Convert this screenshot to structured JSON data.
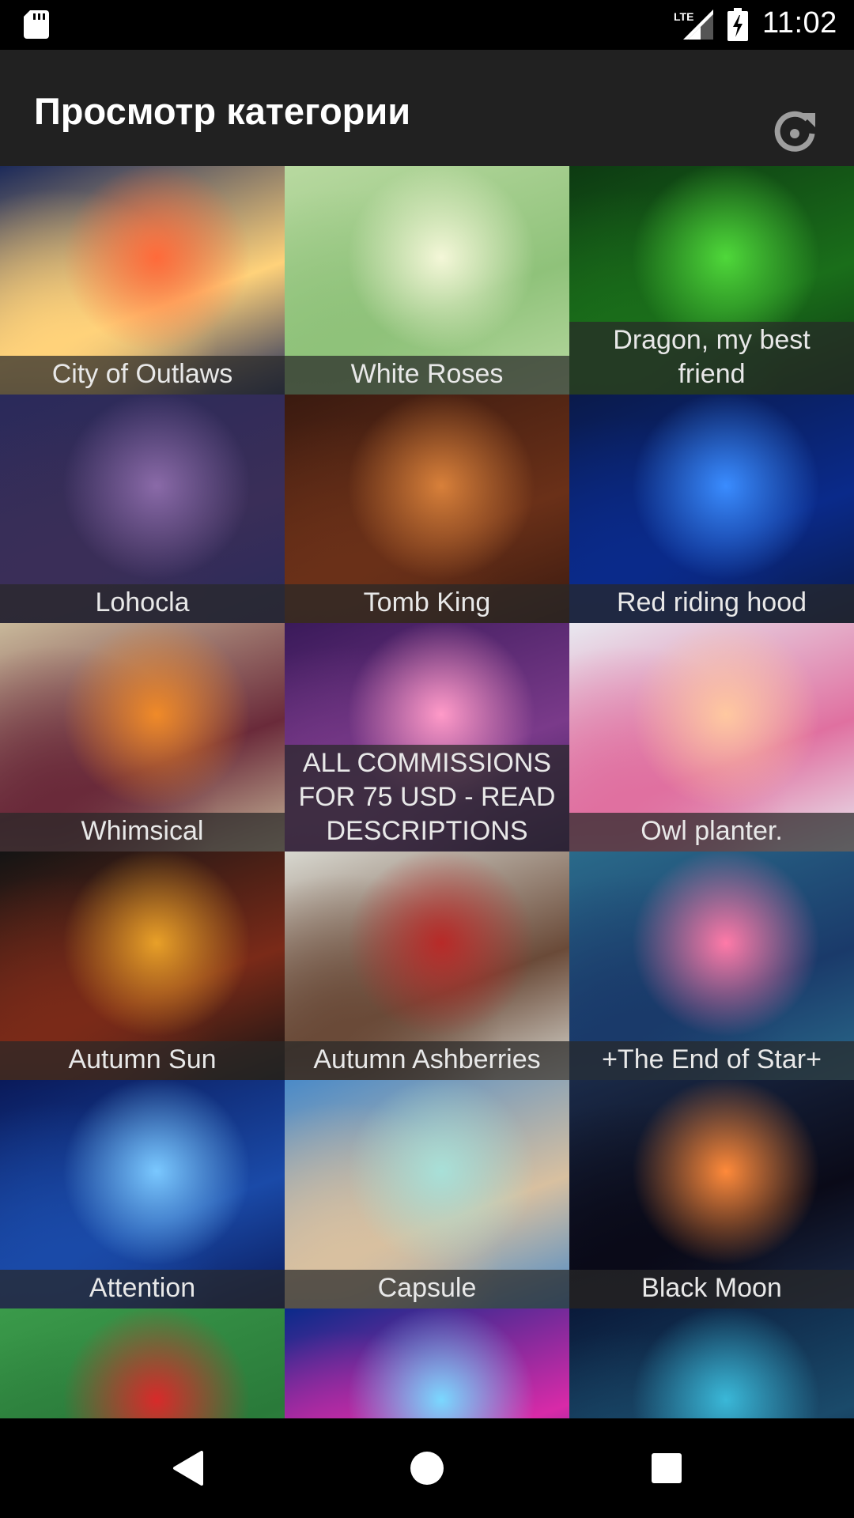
{
  "status_bar": {
    "time": "11:02",
    "network": "LTE",
    "icons": [
      "sd-card-icon",
      "lte-signal-icon",
      "battery-charging-icon"
    ]
  },
  "app_bar": {
    "title": "Просмотр категории",
    "action_icon": "refresh-icon"
  },
  "gallery": {
    "tiles": [
      {
        "caption": "City of Outlaws",
        "palette": [
          "#1c2a5a",
          "#ff6a3a",
          "#ffd27a"
        ]
      },
      {
        "caption": "White Roses",
        "palette": [
          "#b8d9a0",
          "#f4f7d8",
          "#8fc27a"
        ]
      },
      {
        "caption": "Dragon, my best\nfriend",
        "palette": [
          "#0d3a12",
          "#4fd83a",
          "#1a6e1a"
        ]
      },
      {
        "caption": "Lohocla",
        "palette": [
          "#2a2a5a",
          "#8a6aa8",
          "#3a2e58"
        ]
      },
      {
        "caption": "Tomb King",
        "palette": [
          "#3a1a10",
          "#d8803a",
          "#6a3018"
        ]
      },
      {
        "caption": "Red riding hood",
        "palette": [
          "#0a1a4a",
          "#3a8cff",
          "#0a2a8a"
        ]
      },
      {
        "caption": "Whimsical",
        "palette": [
          "#c8b89a",
          "#f08a28",
          "#6a2a3a"
        ]
      },
      {
        "caption": "ALL COMMISSIONS\nFOR 75 USD - READ\nDESCRIPTIONS",
        "palette": [
          "#3a1a5a",
          "#ff9ac8",
          "#7a3a8a"
        ]
      },
      {
        "caption": "Owl planter.",
        "palette": [
          "#e8e8f0",
          "#ffc8a0",
          "#e070a0"
        ]
      },
      {
        "caption": "Autumn Sun",
        "palette": [
          "#141414",
          "#e8a028",
          "#7a2a18"
        ]
      },
      {
        "caption": "Autumn Ashberries",
        "palette": [
          "#d8d8d0",
          "#b82a28",
          "#6a4a38"
        ]
      },
      {
        "caption": "+The End of Star+",
        "palette": [
          "#2a6a8a",
          "#ff7aa8",
          "#1a3a6a"
        ]
      },
      {
        "caption": "Attention",
        "palette": [
          "#0a1a5a",
          "#7ac8ff",
          "#1a4aa8"
        ]
      },
      {
        "caption": "Capsule",
        "palette": [
          "#4a8ac8",
          "#a8e0d8",
          "#d8c0a0"
        ]
      },
      {
        "caption": "Black Moon",
        "palette": [
          "#1a2a48",
          "#ff8a3a",
          "#0a0a18"
        ]
      },
      {
        "caption": "",
        "palette": [
          "#3a9a4a",
          "#d82a2a",
          "#2a7a3a"
        ]
      },
      {
        "caption": "",
        "palette": [
          "#0a2a8a",
          "#7ad8ff",
          "#d82aa8"
        ]
      },
      {
        "caption": "",
        "palette": [
          "#0a1a3a",
          "#3ab8d8",
          "#1a4a6a"
        ]
      }
    ]
  },
  "nav_bar": {
    "icons": [
      "back-icon",
      "home-icon",
      "recents-icon"
    ]
  }
}
